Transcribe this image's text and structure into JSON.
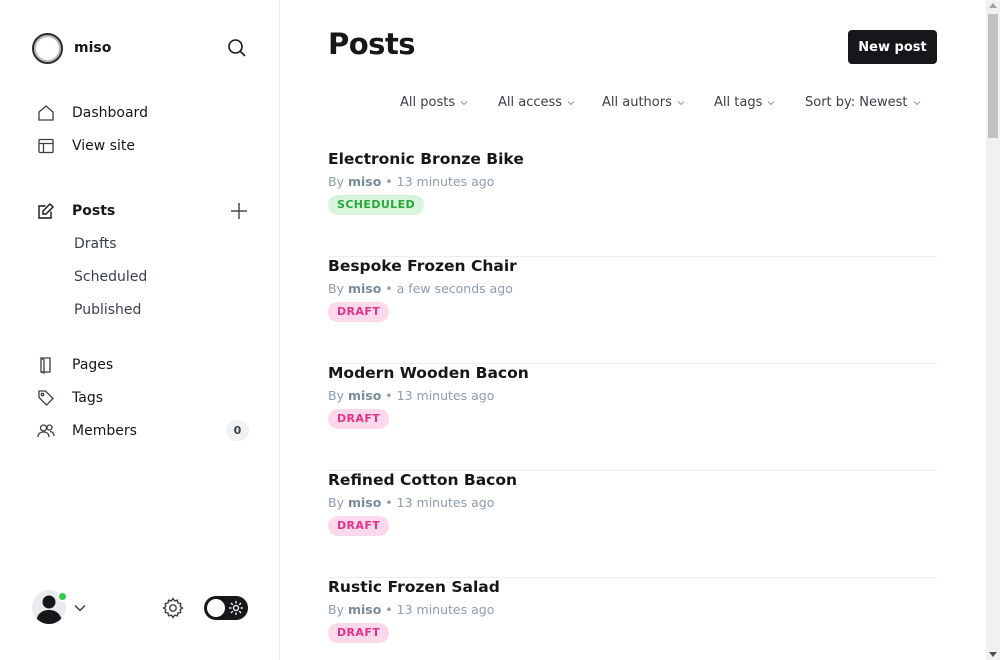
{
  "sidebar": {
    "site_name": "miso",
    "nav": {
      "dashboard": "Dashboard",
      "view_site": "View site",
      "posts": "Posts",
      "drafts": "Drafts",
      "scheduled": "Scheduled",
      "published": "Published",
      "pages": "Pages",
      "tags": "Tags",
      "members": "Members",
      "members_count": "0"
    },
    "icons": {
      "search": "search-icon",
      "plus": "plus-icon",
      "settings": "gear-icon",
      "theme": "sun-icon"
    },
    "theme_toggle": {
      "dark_mode": true
    },
    "user_online": true
  },
  "main": {
    "title": "Posts",
    "new_post_label": "New post",
    "filters": {
      "type": "All posts",
      "access": "All access",
      "authors": "All authors",
      "tags": "All tags",
      "sort": "Sort by: Newest"
    },
    "posts": [
      {
        "title": "Electronic Bronze Bike",
        "by": "By",
        "author": "miso",
        "sep": "•",
        "time": "13 minutes ago",
        "status": "SCHEDULED"
      },
      {
        "title": "Bespoke Frozen Chair",
        "by": "By",
        "author": "miso",
        "sep": "•",
        "time": "a few seconds ago",
        "status": "DRAFT"
      },
      {
        "title": "Modern Wooden Bacon",
        "by": "By",
        "author": "miso",
        "sep": "•",
        "time": "13 minutes ago",
        "status": "DRAFT"
      },
      {
        "title": "Refined Cotton Bacon",
        "by": "By",
        "author": "miso",
        "sep": "•",
        "time": "13 minutes ago",
        "status": "DRAFT"
      },
      {
        "title": "Rustic Frozen Salad",
        "by": "By",
        "author": "miso",
        "sep": "•",
        "time": "13 minutes ago",
        "status": "DRAFT"
      }
    ]
  },
  "colors": {
    "scheduled_bg": "#d6f5db",
    "scheduled_fg": "#29a83c",
    "draft_bg": "#fbd9ea",
    "draft_fg": "#e0348a",
    "primary_button": "#15171a",
    "online_dot": "#30cf43"
  }
}
